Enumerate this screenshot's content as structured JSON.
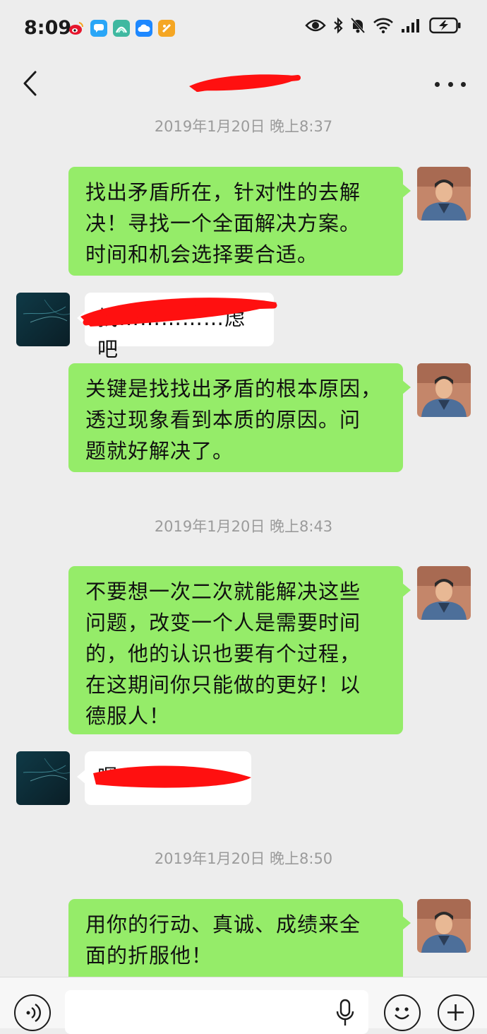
{
  "status_bar": {
    "time": "8:09",
    "app_icons": [
      "weibo-icon",
      "messages-icon",
      "app-store-icon",
      "cloud-icon",
      "wallet-icon"
    ],
    "right_icons": [
      "eye-icon",
      "bluetooth-icon",
      "mute-icon",
      "wifi-icon",
      "signal-icon",
      "battery-charging-icon"
    ]
  },
  "header": {
    "title": "",
    "back_icon": "back-chevron-icon",
    "more_icon": "more-dots-icon"
  },
  "colors": {
    "background": "#ededed",
    "sent_bubble": "#95ec69",
    "received_bubble": "#ffffff",
    "timestamp": "#9b9b9b",
    "redaction": "#ff1010"
  },
  "chat": {
    "timestamps": [
      "2019年1月20日 晚上8:37",
      "2019年1月20日 晚上8:43",
      "2019年1月20日 晚上8:50"
    ],
    "messages": [
      {
        "side": "sent",
        "lines": [
          "找出矛盾所在，针对性的去解",
          "决！寻找一个全面解决方案。",
          "时间和机会选择要合适。"
        ]
      },
      {
        "side": "received",
        "text": "找……………虑吧",
        "redacted": true
      },
      {
        "side": "sent",
        "lines": [
          "关键是找找出矛盾的根本原因，",
          "透过现象看到本质的原因。问",
          "题就好解决了。"
        ]
      },
      {
        "side": "sent",
        "lines": [
          "不要想一次二次就能解决这些",
          "问题，改变一个人是需要时间",
          "的，他的认识也要有个过程，",
          "在这期间你只能做的更好！以",
          "德服人！"
        ]
      },
      {
        "side": "received",
        "text": "嗯，……",
        "redacted": true
      },
      {
        "side": "sent",
        "lines": [
          "用你的行动、真诚、成绩来全",
          "面的折服他！"
        ]
      }
    ]
  },
  "input_bar": {
    "voice_icon": "voice-icon",
    "mic_icon": "mic-icon",
    "emoji_icon": "emoji-icon",
    "plus_icon": "plus-icon",
    "placeholder": ""
  }
}
